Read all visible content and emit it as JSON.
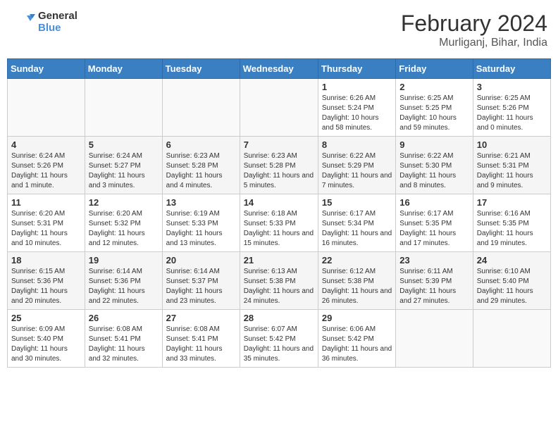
{
  "header": {
    "logo_general": "General",
    "logo_blue": "Blue",
    "title": "February 2024",
    "subtitle": "Murliganj, Bihar, India"
  },
  "weekdays": [
    "Sunday",
    "Monday",
    "Tuesday",
    "Wednesday",
    "Thursday",
    "Friday",
    "Saturday"
  ],
  "weeks": [
    [
      {
        "day": "",
        "sunrise": "",
        "sunset": "",
        "daylight": "",
        "empty": true
      },
      {
        "day": "",
        "sunrise": "",
        "sunset": "",
        "daylight": "",
        "empty": true
      },
      {
        "day": "",
        "sunrise": "",
        "sunset": "",
        "daylight": "",
        "empty": true
      },
      {
        "day": "",
        "sunrise": "",
        "sunset": "",
        "daylight": "",
        "empty": true
      },
      {
        "day": "1",
        "sunrise": "Sunrise: 6:26 AM",
        "sunset": "Sunset: 5:24 PM",
        "daylight": "Daylight: 10 hours and 58 minutes.",
        "empty": false
      },
      {
        "day": "2",
        "sunrise": "Sunrise: 6:25 AM",
        "sunset": "Sunset: 5:25 PM",
        "daylight": "Daylight: 10 hours and 59 minutes.",
        "empty": false
      },
      {
        "day": "3",
        "sunrise": "Sunrise: 6:25 AM",
        "sunset": "Sunset: 5:26 PM",
        "daylight": "Daylight: 11 hours and 0 minutes.",
        "empty": false
      }
    ],
    [
      {
        "day": "4",
        "sunrise": "Sunrise: 6:24 AM",
        "sunset": "Sunset: 5:26 PM",
        "daylight": "Daylight: 11 hours and 1 minute.",
        "empty": false
      },
      {
        "day": "5",
        "sunrise": "Sunrise: 6:24 AM",
        "sunset": "Sunset: 5:27 PM",
        "daylight": "Daylight: 11 hours and 3 minutes.",
        "empty": false
      },
      {
        "day": "6",
        "sunrise": "Sunrise: 6:23 AM",
        "sunset": "Sunset: 5:28 PM",
        "daylight": "Daylight: 11 hours and 4 minutes.",
        "empty": false
      },
      {
        "day": "7",
        "sunrise": "Sunrise: 6:23 AM",
        "sunset": "Sunset: 5:28 PM",
        "daylight": "Daylight: 11 hours and 5 minutes.",
        "empty": false
      },
      {
        "day": "8",
        "sunrise": "Sunrise: 6:22 AM",
        "sunset": "Sunset: 5:29 PM",
        "daylight": "Daylight: 11 hours and 7 minutes.",
        "empty": false
      },
      {
        "day": "9",
        "sunrise": "Sunrise: 6:22 AM",
        "sunset": "Sunset: 5:30 PM",
        "daylight": "Daylight: 11 hours and 8 minutes.",
        "empty": false
      },
      {
        "day": "10",
        "sunrise": "Sunrise: 6:21 AM",
        "sunset": "Sunset: 5:31 PM",
        "daylight": "Daylight: 11 hours and 9 minutes.",
        "empty": false
      }
    ],
    [
      {
        "day": "11",
        "sunrise": "Sunrise: 6:20 AM",
        "sunset": "Sunset: 5:31 PM",
        "daylight": "Daylight: 11 hours and 10 minutes.",
        "empty": false
      },
      {
        "day": "12",
        "sunrise": "Sunrise: 6:20 AM",
        "sunset": "Sunset: 5:32 PM",
        "daylight": "Daylight: 11 hours and 12 minutes.",
        "empty": false
      },
      {
        "day": "13",
        "sunrise": "Sunrise: 6:19 AM",
        "sunset": "Sunset: 5:33 PM",
        "daylight": "Daylight: 11 hours and 13 minutes.",
        "empty": false
      },
      {
        "day": "14",
        "sunrise": "Sunrise: 6:18 AM",
        "sunset": "Sunset: 5:33 PM",
        "daylight": "Daylight: 11 hours and 15 minutes.",
        "empty": false
      },
      {
        "day": "15",
        "sunrise": "Sunrise: 6:17 AM",
        "sunset": "Sunset: 5:34 PM",
        "daylight": "Daylight: 11 hours and 16 minutes.",
        "empty": false
      },
      {
        "day": "16",
        "sunrise": "Sunrise: 6:17 AM",
        "sunset": "Sunset: 5:35 PM",
        "daylight": "Daylight: 11 hours and 17 minutes.",
        "empty": false
      },
      {
        "day": "17",
        "sunrise": "Sunrise: 6:16 AM",
        "sunset": "Sunset: 5:35 PM",
        "daylight": "Daylight: 11 hours and 19 minutes.",
        "empty": false
      }
    ],
    [
      {
        "day": "18",
        "sunrise": "Sunrise: 6:15 AM",
        "sunset": "Sunset: 5:36 PM",
        "daylight": "Daylight: 11 hours and 20 minutes.",
        "empty": false
      },
      {
        "day": "19",
        "sunrise": "Sunrise: 6:14 AM",
        "sunset": "Sunset: 5:36 PM",
        "daylight": "Daylight: 11 hours and 22 minutes.",
        "empty": false
      },
      {
        "day": "20",
        "sunrise": "Sunrise: 6:14 AM",
        "sunset": "Sunset: 5:37 PM",
        "daylight": "Daylight: 11 hours and 23 minutes.",
        "empty": false
      },
      {
        "day": "21",
        "sunrise": "Sunrise: 6:13 AM",
        "sunset": "Sunset: 5:38 PM",
        "daylight": "Daylight: 11 hours and 24 minutes.",
        "empty": false
      },
      {
        "day": "22",
        "sunrise": "Sunrise: 6:12 AM",
        "sunset": "Sunset: 5:38 PM",
        "daylight": "Daylight: 11 hours and 26 minutes.",
        "empty": false
      },
      {
        "day": "23",
        "sunrise": "Sunrise: 6:11 AM",
        "sunset": "Sunset: 5:39 PM",
        "daylight": "Daylight: 11 hours and 27 minutes.",
        "empty": false
      },
      {
        "day": "24",
        "sunrise": "Sunrise: 6:10 AM",
        "sunset": "Sunset: 5:40 PM",
        "daylight": "Daylight: 11 hours and 29 minutes.",
        "empty": false
      }
    ],
    [
      {
        "day": "25",
        "sunrise": "Sunrise: 6:09 AM",
        "sunset": "Sunset: 5:40 PM",
        "daylight": "Daylight: 11 hours and 30 minutes.",
        "empty": false
      },
      {
        "day": "26",
        "sunrise": "Sunrise: 6:08 AM",
        "sunset": "Sunset: 5:41 PM",
        "daylight": "Daylight: 11 hours and 32 minutes.",
        "empty": false
      },
      {
        "day": "27",
        "sunrise": "Sunrise: 6:08 AM",
        "sunset": "Sunset: 5:41 PM",
        "daylight": "Daylight: 11 hours and 33 minutes.",
        "empty": false
      },
      {
        "day": "28",
        "sunrise": "Sunrise: 6:07 AM",
        "sunset": "Sunset: 5:42 PM",
        "daylight": "Daylight: 11 hours and 35 minutes.",
        "empty": false
      },
      {
        "day": "29",
        "sunrise": "Sunrise: 6:06 AM",
        "sunset": "Sunset: 5:42 PM",
        "daylight": "Daylight: 11 hours and 36 minutes.",
        "empty": false
      },
      {
        "day": "",
        "sunrise": "",
        "sunset": "",
        "daylight": "",
        "empty": true
      },
      {
        "day": "",
        "sunrise": "",
        "sunset": "",
        "daylight": "",
        "empty": true
      }
    ]
  ]
}
